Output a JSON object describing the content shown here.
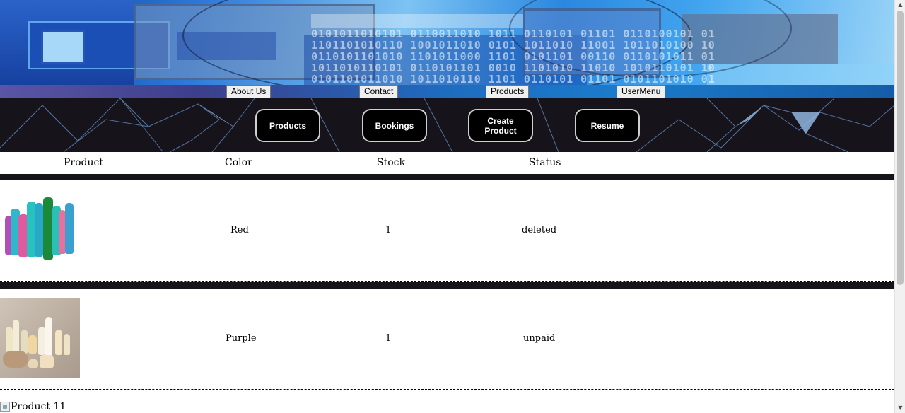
{
  "top_menu": {
    "items": [
      {
        "label": "About Us"
      },
      {
        "label": "Contact"
      },
      {
        "label": "Products"
      },
      {
        "label": "UserMenu"
      }
    ]
  },
  "actions": {
    "products": "Products",
    "bookings": "Bookings",
    "create_product": "Create Product",
    "resume": "Resume"
  },
  "table": {
    "columns": [
      "Product",
      "Color",
      "Stock",
      "Status"
    ],
    "rows": [
      {
        "color": "Red",
        "stock": "1",
        "status": "deleted",
        "image": "cleaning-products-bottles"
      },
      {
        "color": "Purple",
        "stock": "1",
        "status": "unpaid",
        "image": "cosmetic-bottles"
      },
      {
        "image_alt": "Product 11"
      }
    ]
  },
  "colors": {
    "band_dark": "#16131b",
    "button_border": "#cfcfcf",
    "menu_button_bg": "#efefef"
  }
}
